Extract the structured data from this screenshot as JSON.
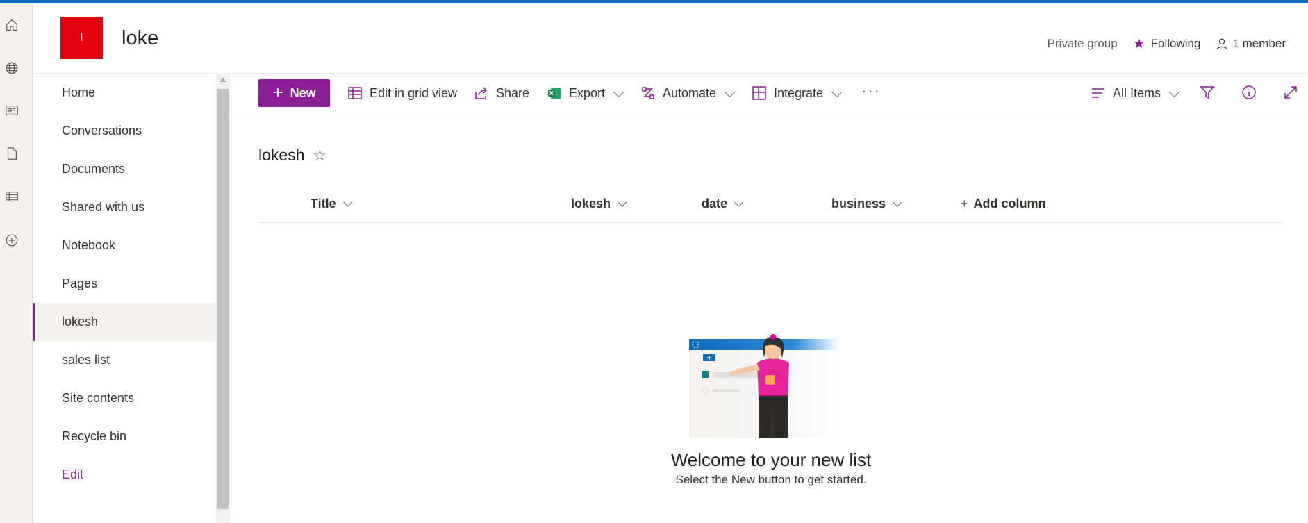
{
  "header": {
    "logo_letter": "l",
    "site_title": "loke",
    "privacy": "Private group",
    "following": "Following",
    "members": "1 member"
  },
  "rail": {
    "icons": [
      "home-icon",
      "globe-icon",
      "news-icon",
      "document-icon",
      "list-icon",
      "add-circle-icon"
    ]
  },
  "nav": {
    "items": [
      {
        "label": "Home"
      },
      {
        "label": "Conversations"
      },
      {
        "label": "Documents"
      },
      {
        "label": "Shared with us"
      },
      {
        "label": "Notebook"
      },
      {
        "label": "Pages"
      },
      {
        "label": "lokesh",
        "selected": true
      },
      {
        "label": "sales list"
      },
      {
        "label": "Site contents"
      },
      {
        "label": "Recycle bin"
      },
      {
        "label": "Edit"
      }
    ]
  },
  "toolbar": {
    "new_label": "New",
    "grid_label": "Edit in grid view",
    "share_label": "Share",
    "export_label": "Export",
    "automate_label": "Automate",
    "integrate_label": "Integrate",
    "more_label": "···",
    "view_label": "All Items"
  },
  "list": {
    "title": "lokesh",
    "columns": [
      "Title",
      "lokesh",
      "date",
      "business"
    ],
    "add_column": "Add column"
  },
  "empty_state": {
    "heading": "Welcome to your new list",
    "subtext": "Select the New button to get started."
  },
  "colors": {
    "accent": "#8c1f97",
    "top_bar": "#0f6cbd",
    "logo": "#e3000f"
  }
}
